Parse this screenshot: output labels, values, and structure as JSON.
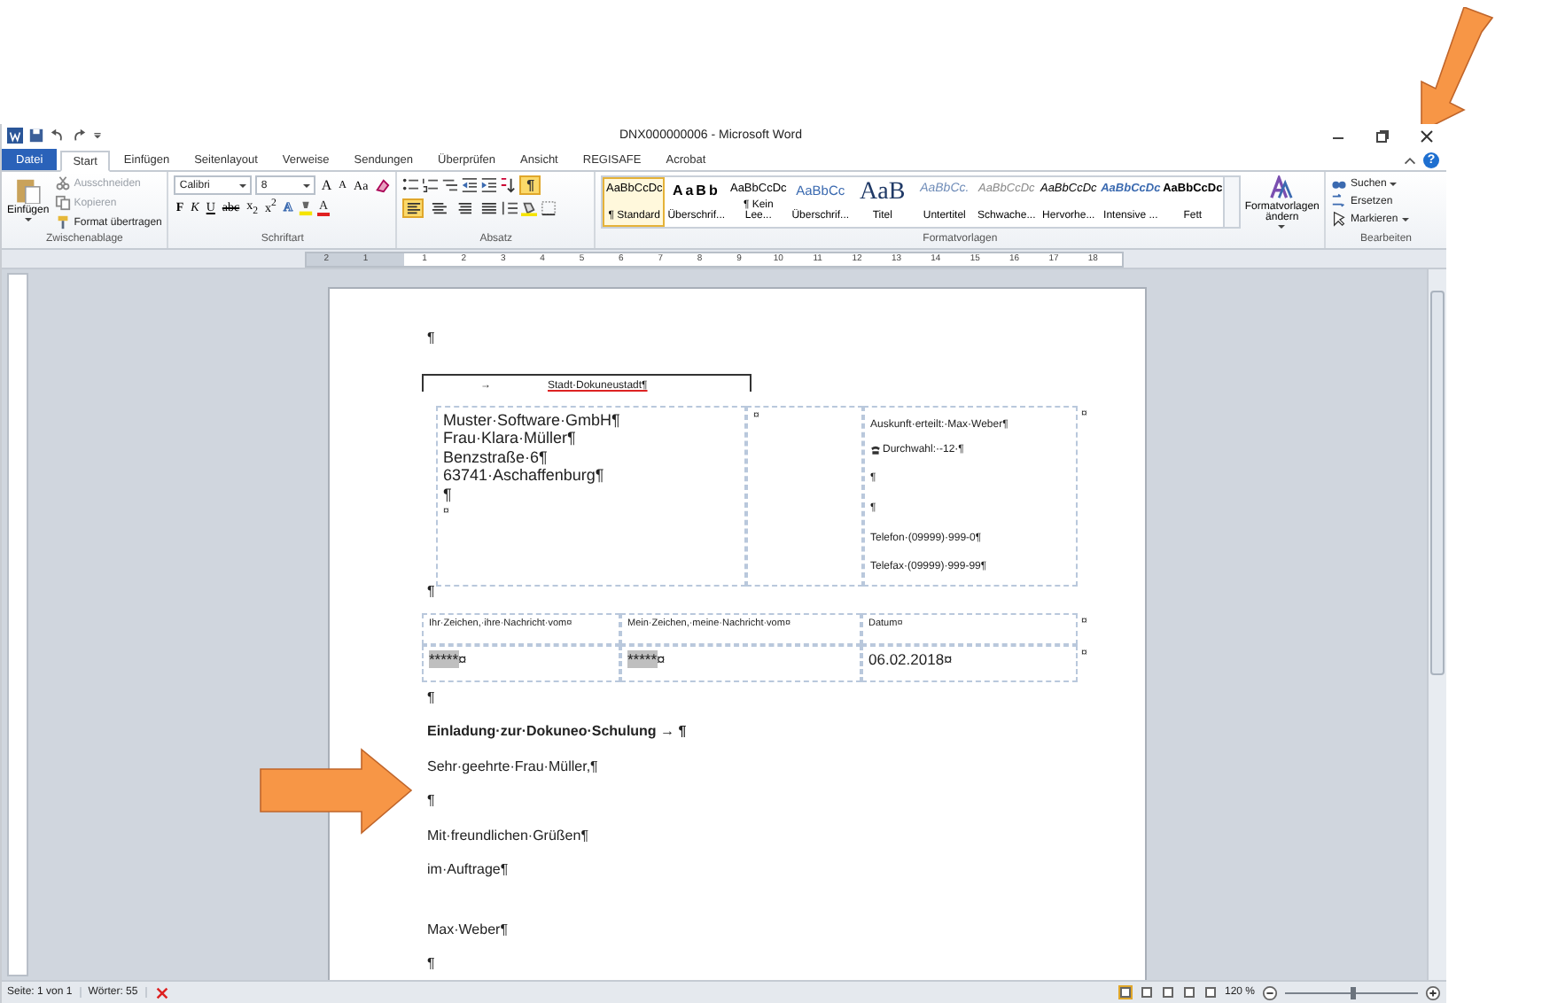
{
  "window": {
    "title": "DNX000000006 - Microsoft Word",
    "help_label": "?"
  },
  "tabs": [
    {
      "label": "Datei",
      "kind": "file",
      "selected": false
    },
    {
      "label": "Start",
      "kind": "tab",
      "selected": true
    },
    {
      "label": "Einfügen",
      "kind": "tab",
      "selected": false
    },
    {
      "label": "Seitenlayout",
      "kind": "tab",
      "selected": false
    },
    {
      "label": "Verweise",
      "kind": "tab",
      "selected": false
    },
    {
      "label": "Sendungen",
      "kind": "tab",
      "selected": false
    },
    {
      "label": "Überprüfen",
      "kind": "tab",
      "selected": false
    },
    {
      "label": "Ansicht",
      "kind": "tab",
      "selected": false
    },
    {
      "label": "REGISAFE",
      "kind": "tab",
      "selected": false
    },
    {
      "label": "Acrobat",
      "kind": "tab",
      "selected": false
    }
  ],
  "clipboard": {
    "name": "Zwischenablage",
    "paste": "Einfügen",
    "items": [
      {
        "label": "Ausschneiden",
        "kind": "cut",
        "disabled": true
      },
      {
        "label": "Kopieren",
        "kind": "copy",
        "disabled": true
      },
      {
        "label": "Format übertragen",
        "kind": "brush",
        "disabled": false
      }
    ]
  },
  "font": {
    "name": "Schriftart",
    "family": "Calibri",
    "size": "8",
    "size_buttons": [
      {
        "label": "A",
        "kind": "grow"
      },
      {
        "label": "A",
        "kind": "shrink"
      },
      {
        "label": "Aa",
        "kind": "case"
      }
    ],
    "format_buttons": [
      {
        "label": "F",
        "kind": "bold"
      },
      {
        "label": "K",
        "kind": "italic"
      },
      {
        "label": "U",
        "kind": "underline"
      },
      {
        "label": "abc",
        "kind": "strike"
      },
      {
        "label": "x$_{2}$",
        "kind": "plain"
      },
      {
        "label": "x$^{2}$",
        "kind": "plain"
      }
    ],
    "color_buttons": [
      {
        "label": "A",
        "kind": "effects"
      },
      {
        "label": "A",
        "kind": "font_color"
      }
    ]
  },
  "paragraph": {
    "name": "Absatz",
    "show_marks": {
      "label": "¶",
      "on": true
    },
    "align_buttons": [
      {
        "selected": true
      },
      {
        "selected": false
      },
      {
        "selected": false
      },
      {
        "selected": false
      }
    ]
  },
  "styles": {
    "name": "Formatvorlagen",
    "change_button": "Formatvorlagen ändern",
    "items": [
      {
        "sample": "AaBbCcDc",
        "label": "¶ Standard",
        "kind": "normal",
        "selected": true
      },
      {
        "sample": "AaBb",
        "label": "Überschrif...",
        "kind": "heading1",
        "selected": false
      },
      {
        "sample": "AaBbCcDc",
        "label": "¶ Kein Lee...",
        "kind": "normal",
        "selected": false
      },
      {
        "sample": "AaBbCc",
        "label": "Überschrif...",
        "kind": "heading2",
        "selected": false
      },
      {
        "sample": "AaB",
        "label": "Titel",
        "kind": "title",
        "selected": false
      },
      {
        "sample": "AaBbCc.",
        "label": "Untertitel",
        "kind": "subtitle",
        "selected": false
      },
      {
        "sample": "AaBbCcDc",
        "label": "Schwache...",
        "kind": "subtle",
        "selected": false
      },
      {
        "sample": "AaBbCcDc",
        "label": "Hervorhe...",
        "kind": "emphasis",
        "selected": false
      },
      {
        "sample": "AaBbCcDc",
        "label": "Intensive ...",
        "kind": "intense",
        "selected": false
      },
      {
        "sample": "AaBbCcDc",
        "label": "Fett",
        "kind": "strong",
        "selected": false
      }
    ]
  },
  "editing": {
    "name": "Bearbeiten",
    "items": [
      {
        "label": "Suchen",
        "kind": "find",
        "dropdown": true
      },
      {
        "label": "Ersetzen",
        "kind": "replace",
        "dropdown": false
      },
      {
        "label": "Markieren",
        "kind": "select",
        "dropdown": true
      }
    ]
  },
  "ruler": {
    "left_numbers": [
      "2",
      "1"
    ],
    "numbers": [
      "1",
      "2",
      "3",
      "4",
      "5",
      "6",
      "7",
      "8",
      "9",
      "10",
      "11",
      "12",
      "13",
      "14",
      "15",
      "16",
      "17",
      "18"
    ]
  },
  "document": {
    "top_mark": "¶",
    "header_frame": {
      "tab": "→",
      "sender": "Stadt·Dokuneustadt¶"
    },
    "address_table": {
      "recipient_lines": [
        "Muster·Software·GmbH¶",
        "Frau·Klara·Müller¶",
        "Benzstraße·6¶",
        "63741·Aschaffenburg¶",
        "¶"
      ],
      "cell_end": "¤",
      "middle_cell": "¤",
      "contact_lines": [
        {
          "text": "Auskunft·erteilt:·Max·Weber¶",
          "kind": "text"
        },
        {
          "text": "Durchwahl:·-12·¶",
          "kind": "phone"
        },
        {
          "text": "¶",
          "kind": "text"
        },
        {
          "text": "¶",
          "kind": "text"
        },
        {
          "text": "Telefon·(09999)·999-0¶",
          "kind": "text"
        },
        {
          "text": "Telefax·(09999)·999-99¶",
          "kind": "text"
        }
      ],
      "row_end": "¤"
    },
    "after_address": "¶",
    "reference_table": {
      "headers": [
        "Ihr·Zeichen,·ihre·Nachricht·vom¤",
        "Mein·Zeichen,·meine·Nachricht·vom¤",
        "Datum¤"
      ],
      "header_row_end": "¤",
      "cells": [
        {
          "value": "*****",
          "end": "¤",
          "shaded": true
        },
        {
          "value": "*****",
          "end": "¤",
          "shaded": true
        },
        {
          "value": "06.02.2018",
          "end": "¤",
          "shaded": false
        }
      ],
      "row_end": "¤"
    },
    "paragraphs": [
      {
        "text": "¶",
        "kind": "plain"
      },
      {
        "text": "Einladung·zur·Dokuneo·Schulung → ¶",
        "kind": "subject"
      },
      {
        "text": "Sehr·geehrte·Frau·Müller,¶",
        "kind": "plain"
      },
      {
        "text": "¶",
        "kind": "plain"
      },
      {
        "text": "Mit·freundlichen·Grüßen¶",
        "kind": "plain"
      },
      {
        "text": "im·Auftrage¶",
        "kind": "plain"
      },
      {
        "text": "Max·Weber¶",
        "kind": "signature"
      },
      {
        "text": "¶",
        "kind": "plain"
      }
    ]
  },
  "status_bar": {
    "page": "Seite: 1 von 1",
    "words": "Wörter: 55",
    "views": [
      {
        "selected": true
      },
      {
        "selected": false
      },
      {
        "selected": false
      },
      {
        "selected": false
      },
      {
        "selected": false
      }
    ],
    "zoom": "120 %",
    "zoom_slider": {
      "level": 0.5
    }
  }
}
